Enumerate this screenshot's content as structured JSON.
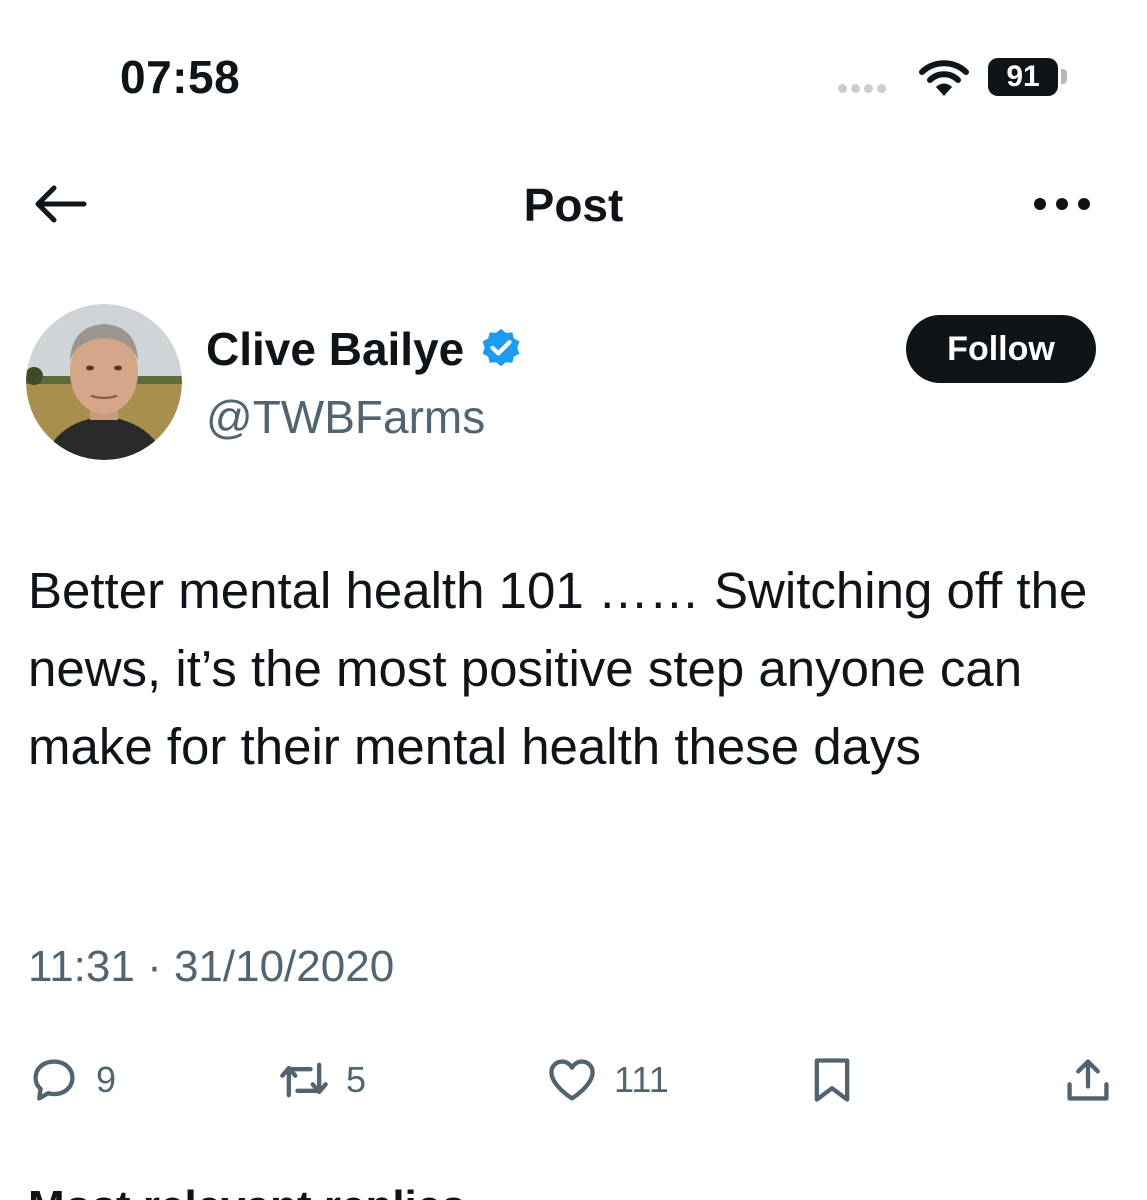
{
  "status_bar": {
    "time": "07:58",
    "battery": "91"
  },
  "header": {
    "title": "Post"
  },
  "author": {
    "name": "Clive Bailye",
    "handle": "@TWBFarms",
    "follow_label": "Follow"
  },
  "post": {
    "text": "Better mental health 101 ……  Switching off the news, it’s the most positive step anyone can make for their mental health these days",
    "timestamp": "11:31 · 31/10/2020"
  },
  "actions": {
    "replies": "9",
    "reposts": "5",
    "likes": "111"
  },
  "next_section": {
    "label": "Most relevant replies"
  },
  "icons": {
    "back": "back-arrow-icon",
    "more": "more-horizontal-icon",
    "verified": "verified-badge-icon",
    "reply": "reply-icon",
    "repost": "repost-icon",
    "like": "heart-icon",
    "bookmark": "bookmark-icon",
    "share": "share-icon"
  },
  "colors": {
    "verified": "#1d9bf0",
    "text": "#0f1419",
    "secondary": "#536471",
    "button": "#0f1419"
  }
}
